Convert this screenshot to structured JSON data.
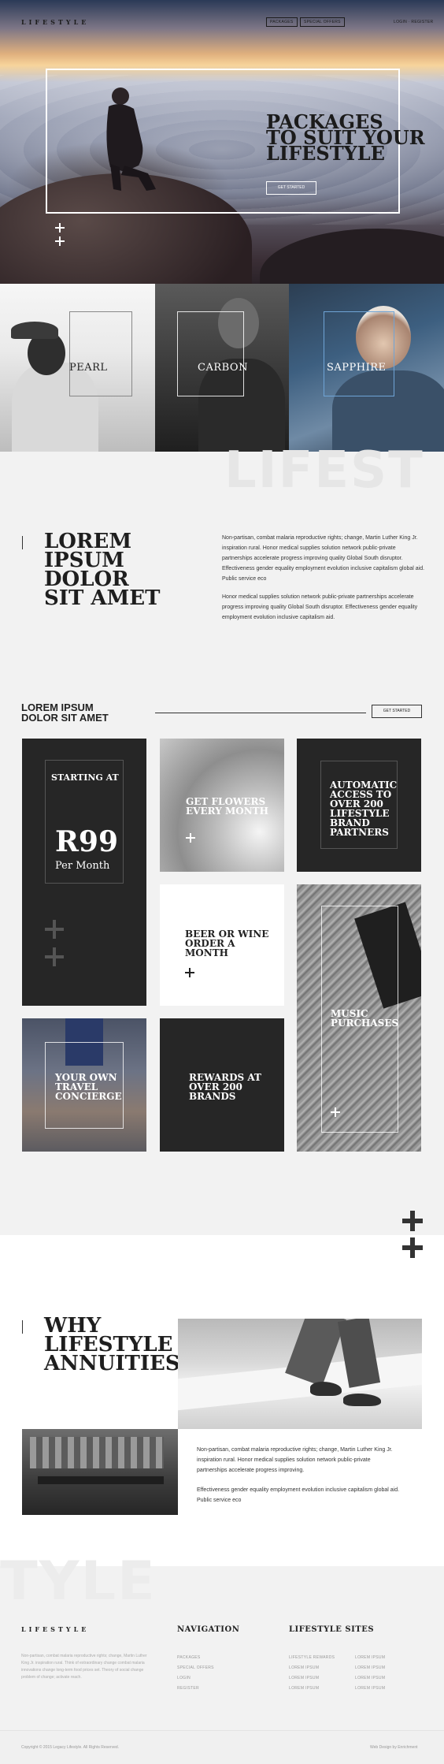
{
  "header": {
    "logo": "LIFESTYLE",
    "nav_packages": "PACKAGES",
    "nav_special_offers": "SPECIAL OFFERS",
    "nav_login_register": "LOGIN · REGISTER"
  },
  "hero": {
    "title_line1": "PACKAGES",
    "title_line2": "TO SUIT YOUR",
    "title_line3": "LIFESTYLE",
    "cta": "GET STARTED"
  },
  "packages": [
    {
      "label": "PEARL"
    },
    {
      "label": "CARBON"
    },
    {
      "label": "SAPPHIRE"
    }
  ],
  "intro": {
    "bg_word": "LIFEST",
    "title_line1": "LOREM",
    "title_line2": "IPSUM",
    "title_line3": "DOLOR",
    "title_line4": "SIT AMET",
    "paragraph1": "Non-partisan, combat malaria reproductive rights; change, Martin Luther King Jr. inspiration rural. Honor medical supplies solution network public-private partnerships accelerate progress improving quality Global South disruptor. Effectiveness gender equality employment evolution inclusive capitalism global aid. Public service eco",
    "paragraph2": "Honor medical supplies solution network public-private partnerships accelerate progress improving quality Global South disruptor. Effectiveness gender equality employment evolution inclusive capitalism aid."
  },
  "grid": {
    "title_line1": "LOREM IPSUM",
    "title_line2": "DOLOR SIT AMET",
    "cta": "GET STARTED",
    "starting_at": "STARTING AT",
    "price": "R99",
    "per": "Per Month",
    "flowers_line1": "GET FLOWERS",
    "flowers_line2": "EVERY MONTH",
    "automatic_line1": "AUTOMATIC",
    "automatic_line2": "ACCESS TO",
    "automatic_line3": "OVER 200",
    "automatic_line4": "LIFESTYLE",
    "automatic_line5": "BRAND",
    "automatic_line6": "PARTNERS",
    "beer_line1": "BEER OR WINE",
    "beer_line2": "ORDER A",
    "beer_line3": "MONTH",
    "music_line1": "MUSIC",
    "music_line2": "PURCHASES",
    "travel_line1": "YOUR OWN",
    "travel_line2": "TRAVEL",
    "travel_line3": "CONCIERGE",
    "rewards_line1": "REWARDS AT",
    "rewards_line2": "OVER 200",
    "rewards_line3": "BRANDS"
  },
  "why": {
    "title_line1": "WHY",
    "title_line2": "LIFESTYLE",
    "title_line3": "ANNUITIES",
    "paragraph1": "Non-partisan, combat malaria reproductive rights; change, Martin Luther King Jr. inspiration rural. Honor medical supplies solution network public-private partnerships accelerate progress improving.",
    "paragraph2": "Effectiveness gender equality employment evolution inclusive capitalism global aid. Public service eco",
    "bg_word": "TYLE"
  },
  "footer": {
    "logo": "LIFESTYLE",
    "description": "Non-partisan, combat malaria reproductive rights; change, Martin Luther King Jr. inspiration rural. Think of extraordinary change combat malaria innovations change long-term food prices set. Theory of social change problem of change; activate reach.",
    "nav_heading": "NAVIGATION",
    "nav_links": [
      "PACKAGES",
      "SPECIAL OFFERS",
      "LOGIN",
      "REGISTER"
    ],
    "sites_heading": "LIFESTYLE SITES",
    "sites_col1": [
      "LIFESTYLE REWARDS",
      "LOREM IPSUM",
      "LOREM IPSUM",
      "LOREM IPSUM"
    ],
    "sites_col2": [
      "LOREM IPSUM",
      "LOREM IPSUM",
      "LOREM IPSUM",
      "LOREM IPSUM"
    ],
    "copyright": "Copyright © 2015 Legacy Lifestyle. All Rights Reserved.",
    "credit": "Web Design by Enrichment"
  },
  "colors": {
    "dark_tile": "#262626",
    "accent_text": "#1e1e1e",
    "background": "#f2f2f2"
  }
}
